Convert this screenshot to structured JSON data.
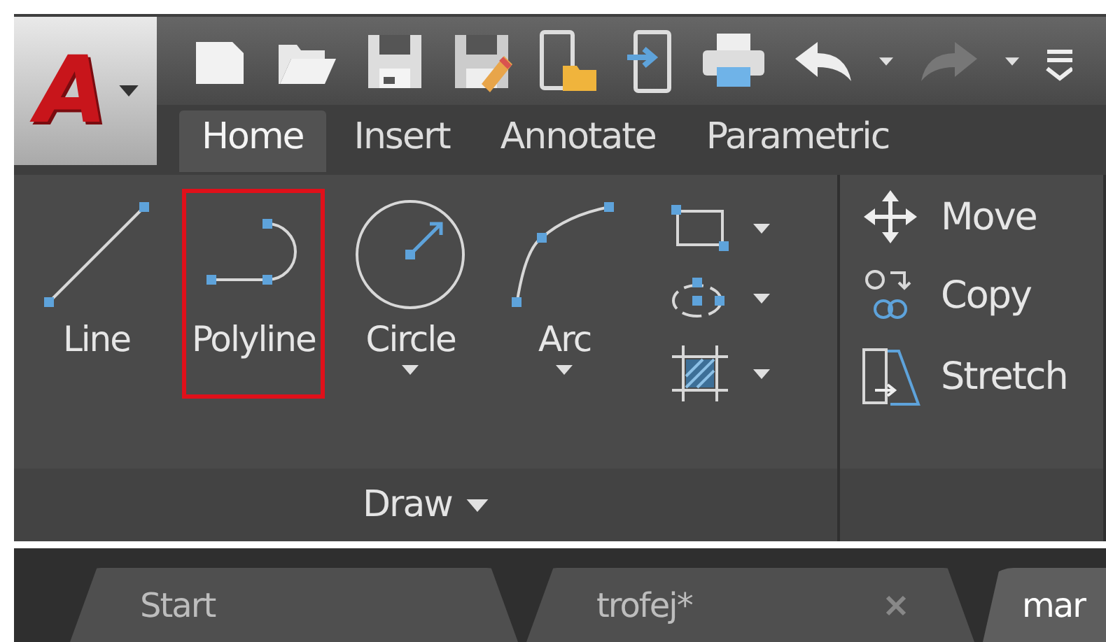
{
  "app_button": {
    "logo": "A"
  },
  "ribbon_tabs": [
    {
      "label": "Home",
      "selected": true
    },
    {
      "label": "Insert",
      "selected": false
    },
    {
      "label": "Annotate",
      "selected": false
    },
    {
      "label": "Parametric",
      "selected": false
    }
  ],
  "draw_panel": {
    "title": "Draw",
    "tools": [
      {
        "label": "Line",
        "dropdown": false,
        "highlighted": false
      },
      {
        "label": "Polyline",
        "dropdown": false,
        "highlighted": true
      },
      {
        "label": "Circle",
        "dropdown": true,
        "highlighted": false
      },
      {
        "label": "Arc",
        "dropdown": true,
        "highlighted": false
      }
    ]
  },
  "modify_panel": {
    "tools": [
      {
        "label": "Move"
      },
      {
        "label": "Copy"
      },
      {
        "label": "Stretch"
      }
    ]
  },
  "file_tabs": [
    {
      "label": "Start",
      "selected": false,
      "closable": false
    },
    {
      "label": "trofej*",
      "selected": false,
      "closable": true
    },
    {
      "label": "mar",
      "selected": true,
      "closable": false
    }
  ]
}
